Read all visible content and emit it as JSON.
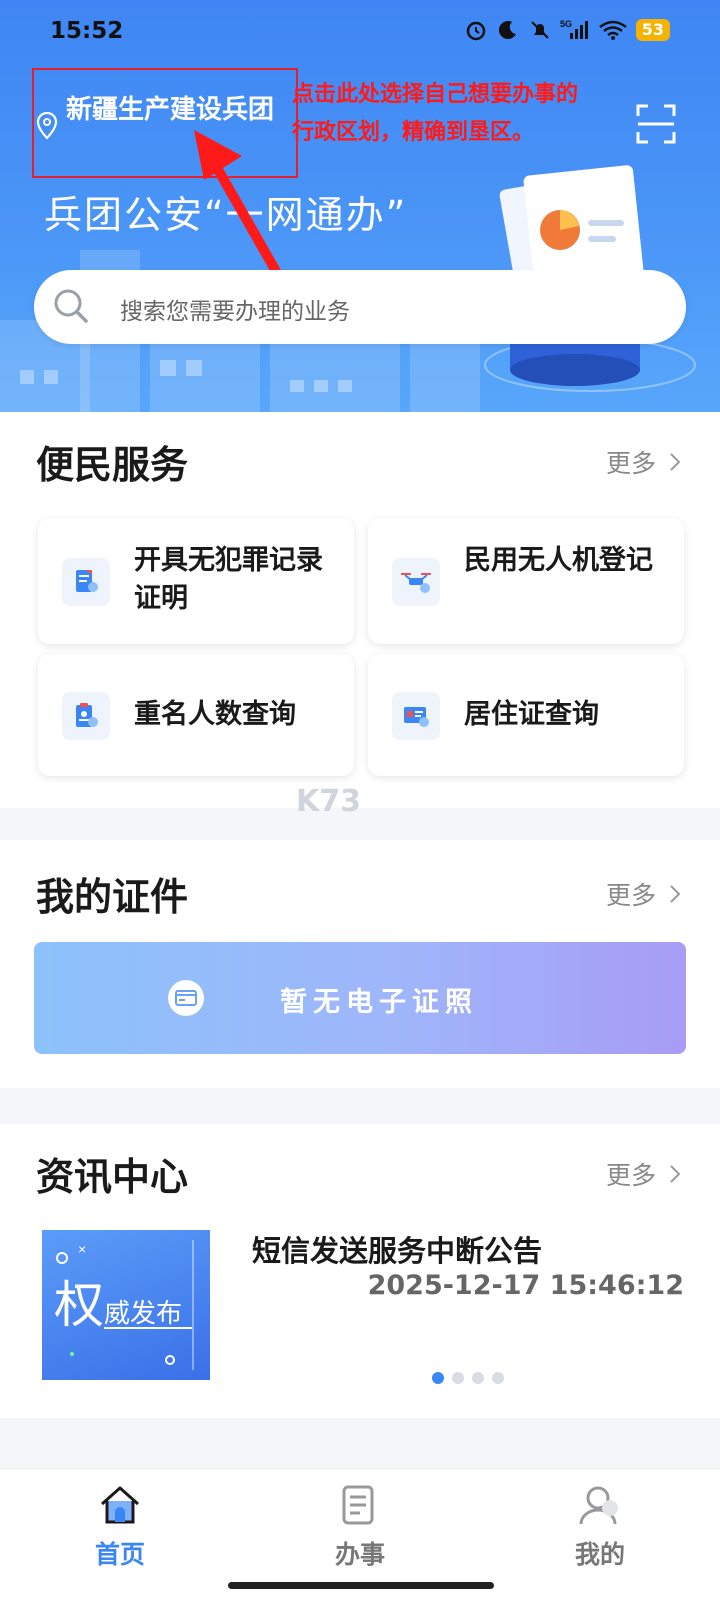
{
  "status_bar": {
    "time": "15:52",
    "battery": "53",
    "network": "5G"
  },
  "header": {
    "location": "新疆生产建设兵团",
    "annotation": "点击此处选择自己想要办事的行政区划，精确到垦区。",
    "title": "兵团公安“一网通办”",
    "search_placeholder": "搜索您需要办理的业务"
  },
  "services": {
    "title": "便民服务",
    "more": "更多",
    "items": [
      {
        "label": "开具无犯罪记录证明",
        "icon": "certificate-doc-icon"
      },
      {
        "label": "民用无人机登记",
        "icon": "drone-icon"
      },
      {
        "label": "重名人数查询",
        "icon": "clipboard-person-icon"
      },
      {
        "label": "居住证查询",
        "icon": "id-card-icon"
      }
    ]
  },
  "watermark": "K73",
  "certificates": {
    "title": "我的证件",
    "more": "更多",
    "empty_text": "暂无电子证照"
  },
  "news": {
    "title": "资讯中心",
    "more": "更多",
    "image_text": "权威发布",
    "item_title": "短信发送服务中断公告",
    "item_date": "2025-12-17 15:46:12",
    "page_count": 4,
    "current_page": 1
  },
  "tabbar": {
    "tabs": [
      {
        "label": "首页",
        "icon": "home-icon",
        "active": true
      },
      {
        "label": "办事",
        "icon": "document-icon",
        "active": false
      },
      {
        "label": "我的",
        "icon": "user-icon",
        "active": false
      }
    ]
  },
  "colors": {
    "accent": "#3a86f5",
    "annotation": "#ff1a1a",
    "hero": "#4a95f7"
  }
}
